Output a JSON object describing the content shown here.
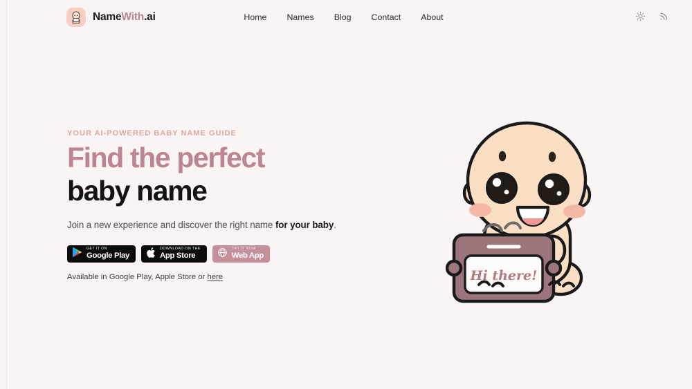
{
  "brand": {
    "name_part_1": "Name",
    "name_part_2": "With",
    "name_part_3": ".ai",
    "logo_icon": "baby-avatar-icon",
    "logo_bg": "#f8cfc4"
  },
  "nav": {
    "items": [
      {
        "label": "Home"
      },
      {
        "label": "Names"
      },
      {
        "label": "Blog"
      },
      {
        "label": "Contact"
      },
      {
        "label": "About"
      }
    ]
  },
  "header_tools": {
    "theme_toggle_icon": "sun-icon",
    "rss_icon": "rss-feed-icon"
  },
  "hero": {
    "eyebrow": "YOUR AI-POWERED BABY NAME GUIDE",
    "headline_line_1": "Find the perfect",
    "headline_line_2": "baby name",
    "subhead_lead": "Join a new experience and discover the right name ",
    "subhead_bold": "for your baby",
    "subhead_tail": ".",
    "availability_lead": "Available in Google Play, Apple Store or ",
    "availability_link": "here",
    "badges": [
      {
        "top_label": "GET IT ON",
        "main_label": "Google Play",
        "icon": "google-play-icon",
        "style": "dark"
      },
      {
        "top_label": "Download on the",
        "main_label": "App Store",
        "icon": "apple-logo-icon",
        "style": "dark"
      },
      {
        "top_label": "Try it now",
        "main_label": "Web App",
        "icon": "globe-icon",
        "style": "rose"
      }
    ],
    "illustration": {
      "name": "baby-holding-sign-illustration",
      "sign_text": "Hi there!"
    }
  },
  "colors": {
    "page_background": "#faf4f4",
    "accent_rose": "#bd8591",
    "eyebrow_rose": "#dba7a7",
    "headline_dark": "#141414",
    "badge_rose": "#c39099",
    "skin": "#fadfc4",
    "outline": "#1a1a1a"
  }
}
